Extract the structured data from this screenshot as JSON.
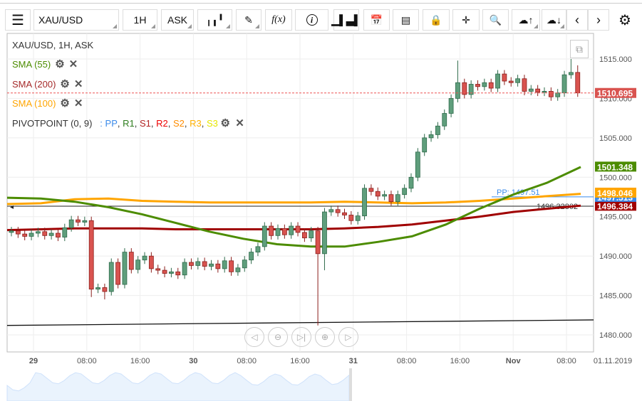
{
  "toolbar": {
    "symbol": "XAU/USD",
    "timeframe": "1H",
    "side": "ASK",
    "fx": "f(x)"
  },
  "legend": {
    "title": "XAU/USD, 1H, ASK",
    "sma55": "SMA (55)",
    "sma200": "SMA (200)",
    "sma100": "SMA (100)",
    "pivot": "PIVOTPOINT (0, 9)",
    "pivot_sep": ":",
    "pp": "PP",
    "r1": "R1",
    "s1": "S1",
    "r2": "R2",
    "s2": "S2",
    "r3": "R3",
    "s3": "S3"
  },
  "colors": {
    "up": "#5f9e7c",
    "down": "#d9534f",
    "sma55": "#4c8c00",
    "sma200": "#a00000",
    "sma100": "#ffa500",
    "pp": "#3b8bea"
  },
  "chart_data": {
    "type": "candlestick",
    "ylim": [
      1479,
      1519
    ],
    "yticks": [
      "1515.000",
      "1510.000",
      "1505.000",
      "1500.000",
      "1495.000",
      "1490.000",
      "1485.000",
      "1480.000"
    ],
    "ytick_values": [
      1515,
      1510,
      1505,
      1500,
      1495,
      1490,
      1485,
      1480
    ],
    "xticks": [
      {
        "label": "29",
        "hour": 0,
        "bold": true
      },
      {
        "label": "08:00",
        "hour": 8
      },
      {
        "label": "16:00",
        "hour": 16
      },
      {
        "label": "30",
        "hour": 24,
        "bold": true
      },
      {
        "label": "08:00",
        "hour": 32
      },
      {
        "label": "16:00",
        "hour": 40
      },
      {
        "label": "31",
        "hour": 48,
        "bold": true
      },
      {
        "label": "08:00",
        "hour": 56
      },
      {
        "label": "16:00",
        "hour": 64
      },
      {
        "label": "Nov",
        "hour": 72,
        "bold": true
      },
      {
        "label": "08:00",
        "hour": 80
      }
    ],
    "date_label": "01.11.2019",
    "first_open": 1493.0,
    "close": [
      1493.2,
      1492.8,
      1492.5,
      1492.9,
      1493.1,
      1492.6,
      1492.9,
      1492.4,
      1493.6,
      1494.6,
      1494.3,
      1494.5,
      1485.8,
      1486.0,
      1485.5,
      1489.2,
      1486.4,
      1490.5,
      1488.3,
      1489.5,
      1490.0,
      1488.4,
      1488.2,
      1487.8,
      1488.0,
      1487.6,
      1489.2,
      1488.8,
      1489.3,
      1488.7,
      1489.0,
      1488.4,
      1489.4,
      1488.0,
      1488.5,
      1489.5,
      1490.5,
      1491.2,
      1493.8,
      1492.6,
      1493.5,
      1492.7,
      1493.8,
      1493.0,
      1492.3,
      1493.2,
      1490.3,
      1495.6,
      1495.9,
      1495.5,
      1495.2,
      1494.5,
      1495.1,
      1498.6,
      1498.2,
      1497.6,
      1497.8,
      1496.9,
      1497.8,
      1498.6,
      1500.0,
      1503.2,
      1505.0,
      1505.4,
      1506.5,
      1508.1,
      1510.0,
      1512.0,
      1510.5,
      1511.8,
      1511.5,
      1512.0,
      1511.3,
      1513.1,
      1512.2,
      1512.0,
      1512.5,
      1510.9,
      1511.2,
      1510.8,
      1510.9,
      1510.2,
      1510.7,
      1513.0,
      1513.3,
      1510.7
    ],
    "wick_lows": {
      "12": 1484.8,
      "14": 1484.5,
      "46": 1481.2,
      "47": 1488.2
    },
    "wick_highs": {
      "67": 1514.8,
      "84": 1515.0,
      "85": 1514.2
    },
    "sma55": {
      "name": "SMA (55)",
      "values": [
        1497.4,
        1497.3,
        1496.9,
        1496.2,
        1495.3,
        1494.2,
        1493.1,
        1492.2,
        1491.5,
        1491.2,
        1491.2,
        1491.8,
        1492.5,
        1494.0,
        1496.0,
        1497.8,
        1499.3,
        1501.3
      ]
    },
    "sma100": {
      "name": "SMA (100)",
      "values": [
        1496.6,
        1496.7,
        1497.2,
        1497.3,
        1497.0,
        1496.9,
        1496.8,
        1496.8,
        1496.8,
        1496.8,
        1496.9,
        1496.8,
        1496.7,
        1496.8,
        1497.0,
        1497.3,
        1497.6,
        1497.9
      ]
    },
    "sma200": {
      "name": "SMA (200)",
      "values": [
        1493.3,
        1493.4,
        1493.5,
        1493.5,
        1493.5,
        1493.4,
        1493.4,
        1493.4,
        1493.4,
        1493.4,
        1493.5,
        1493.7,
        1494.0,
        1494.5,
        1495.0,
        1495.6,
        1496.0,
        1496.4
      ]
    },
    "pp_label": "PP: 1497.51",
    "pp_value": 1497.51,
    "hline_label": "1496.32802",
    "hline_value": 1496.328,
    "trendline": [
      1481.2,
      1481.9
    ],
    "current_price": 1510.695,
    "axis_labels": [
      {
        "text": "1510.695",
        "value": 1510.695,
        "color": "#d9534f"
      },
      {
        "text": "1501.348",
        "value": 1501.348,
        "color": "#4c8c00"
      },
      {
        "text": "1498.046",
        "value": 1498.046,
        "color": "#ffa500"
      },
      {
        "text": "1497.513",
        "value": 1497.513,
        "color": "#3b8bea"
      },
      {
        "text": "1496.384",
        "value": 1496.384,
        "color": "#a00000"
      }
    ]
  }
}
